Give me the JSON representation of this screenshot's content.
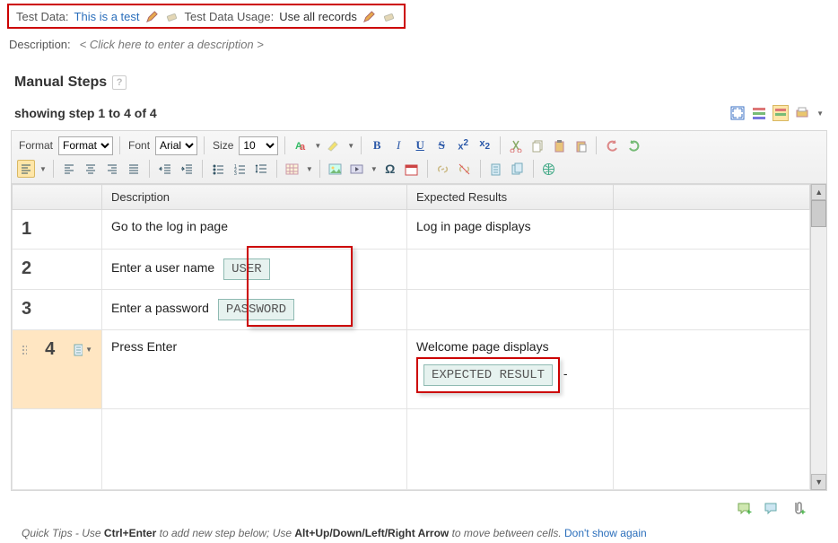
{
  "header": {
    "test_data_label": "Test Data:",
    "test_data_value": "This is a test",
    "usage_label": "Test Data Usage:",
    "usage_value": "Use all records",
    "description_label": "Description:",
    "description_placeholder": "< Click here to enter a description >"
  },
  "section": {
    "title": "Manual Steps",
    "counter": "showing step 1 to 4 of 4"
  },
  "toolbar": {
    "format_label": "Format",
    "format_value": "Format",
    "font_label": "Font",
    "font_value": "Arial",
    "size_label": "Size",
    "size_value": "10"
  },
  "columns": {
    "step": "",
    "description": "Description",
    "expected": "Expected Results"
  },
  "steps": [
    {
      "num": "1",
      "description": "Go to the log in page",
      "param": null,
      "expected_text": "Log in page displays",
      "expected_param": null,
      "highlighted": false
    },
    {
      "num": "2",
      "description": "Enter a user name",
      "param": "USER",
      "expected_text": "",
      "expected_param": null,
      "highlighted": false
    },
    {
      "num": "3",
      "description": "Enter a password",
      "param": "PASSWORD",
      "expected_text": "",
      "expected_param": null,
      "highlighted": false
    },
    {
      "num": "4",
      "description": "Press Enter",
      "param": null,
      "expected_text": "Welcome page displays",
      "expected_param": "EXPECTED RESULT",
      "highlighted": true
    }
  ],
  "tips": {
    "prefix": "Quick Tips",
    "text_before": " - Use ",
    "shortcut1": "Ctrl+Enter",
    "mid": " to add new step below; Use ",
    "shortcut2": "Alt+Up/Down/Left/Right Arrow",
    "after": " to move between cells. ",
    "link": "Don't show again"
  }
}
